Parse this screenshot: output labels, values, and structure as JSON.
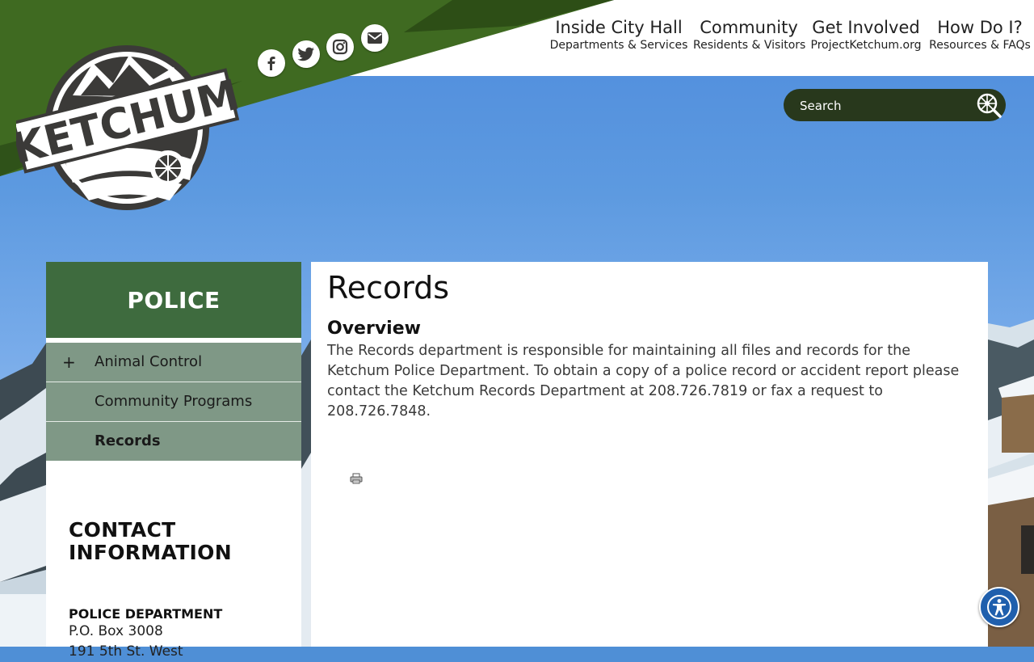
{
  "header": {
    "nav": [
      {
        "main": "Inside City Hall",
        "sub": "Departments & Services"
      },
      {
        "main": "Community",
        "sub": "Residents & Visitors"
      },
      {
        "main": "Get Involved",
        "sub": "ProjectKetchum.org"
      },
      {
        "main": "How Do I?",
        "sub": "Resources & FAQs"
      }
    ],
    "logo_text": "KETCHUM",
    "social": [
      "facebook-icon",
      "twitter-icon",
      "instagram-icon",
      "email-icon"
    ]
  },
  "search": {
    "placeholder": "Search"
  },
  "sidebar": {
    "title": "POLICE",
    "items": [
      {
        "label": "Animal Control",
        "expand": "+"
      },
      {
        "label": "Community Programs",
        "expand": ""
      },
      {
        "label": "Records",
        "expand": "",
        "active": true
      }
    ],
    "contact": {
      "heading_line1": "CONTACT",
      "heading_line2": "INFORMATION",
      "dept": "POLICE DEPARTMENT",
      "line1": "P.O. Box 3008",
      "line2": "191 5th St. West"
    }
  },
  "main": {
    "title": "Records",
    "subtitle": "Overview",
    "body": "The Records department is responsible for maintaining all files and records for the Ketchum Police Department. To obtain a copy of a police record or accident report please contact the Ketchum Records Department at 208.726.7819 or fax a request to 208.726.7848."
  },
  "colors": {
    "header_green": "#3f6a21",
    "sidebar_title": "#3e6b3e",
    "sidebar_item": "#7f9886",
    "search_bg": "#28381c",
    "accessibility": "#1f5fad"
  }
}
